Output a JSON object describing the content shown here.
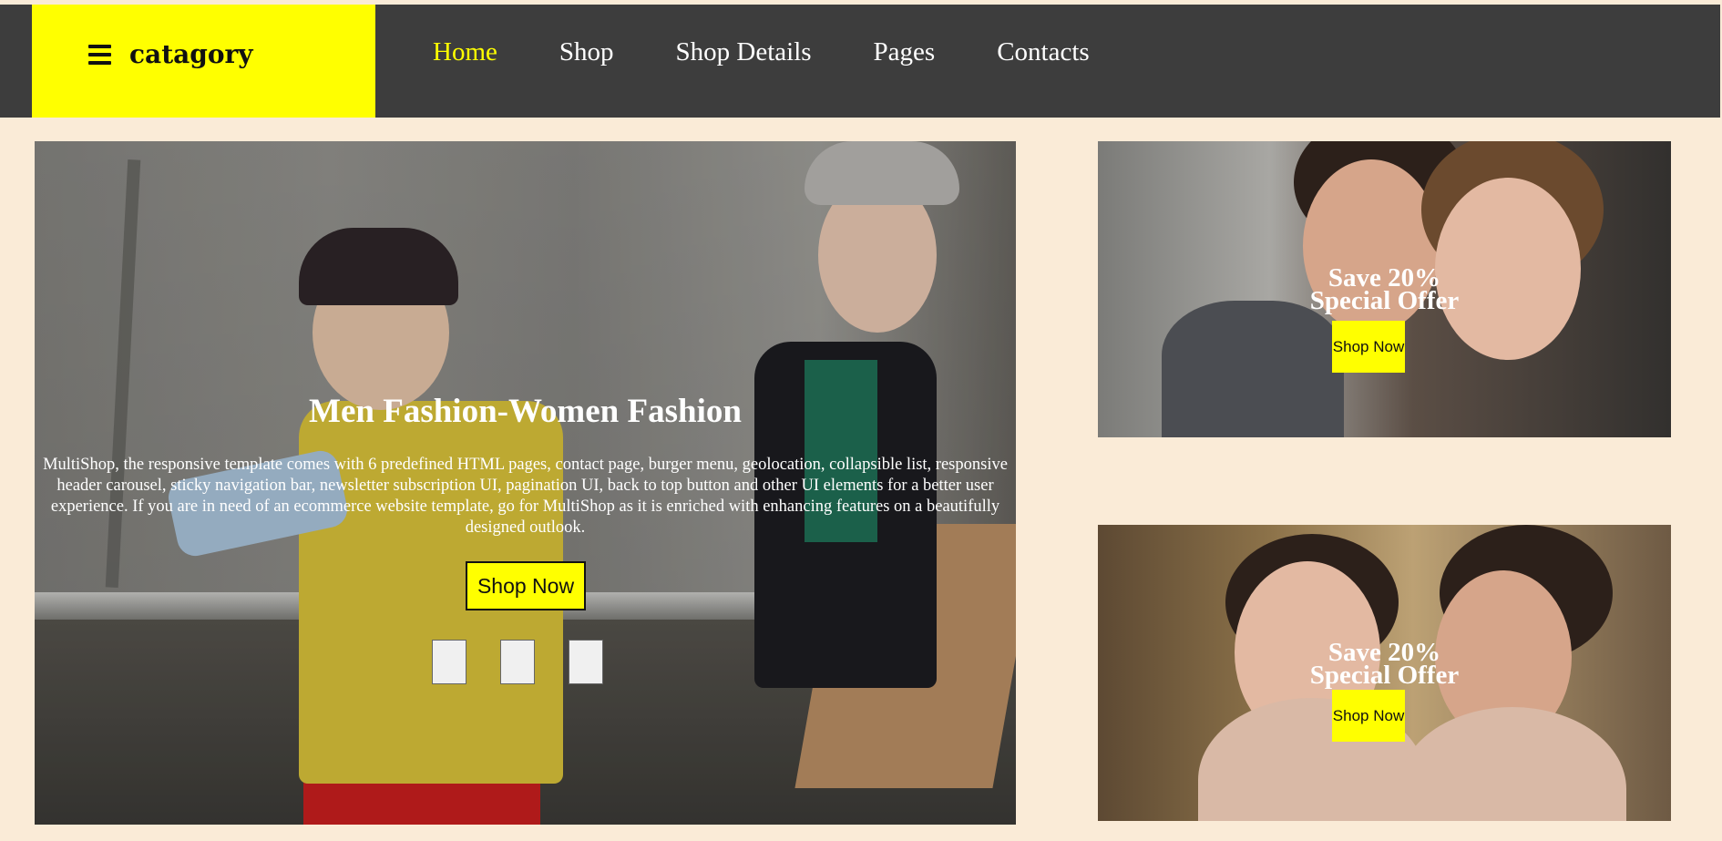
{
  "navbar": {
    "category_label": "catagory",
    "links": [
      {
        "label": "Home",
        "active": true
      },
      {
        "label": "Shop",
        "active": false
      },
      {
        "label": "Shop Details",
        "active": false
      },
      {
        "label": "Pages",
        "active": false
      },
      {
        "label": "Contacts",
        "active": false
      }
    ]
  },
  "hero": {
    "title": "Men Fashion-Women Fashion",
    "description": "MultiShop, the responsive template comes with 6 predefined HTML pages, contact page, burger menu, geolocation, collapsible list, responsive header carousel, sticky navigation bar, newsletter subscription UI, pagination UI, back to top button and other UI elements for a better user experience. If you are in need of an ecommerce website template, go for MultiShop as it is enriched with enhancing features on a beautifully designed outlook.",
    "button_label": "Shop Now",
    "carousel_indicators": 3
  },
  "offers": [
    {
      "line1": "Save 20%",
      "line2": "Special Offer",
      "button_label": "Shop Now"
    },
    {
      "line1": "Save 20%",
      "line2": "Special Offer",
      "button_label": "Shop Now"
    }
  ],
  "colors": {
    "accent": "#ffff00",
    "nav_bg": "#3d3d3d",
    "page_bg": "#faebd7"
  }
}
